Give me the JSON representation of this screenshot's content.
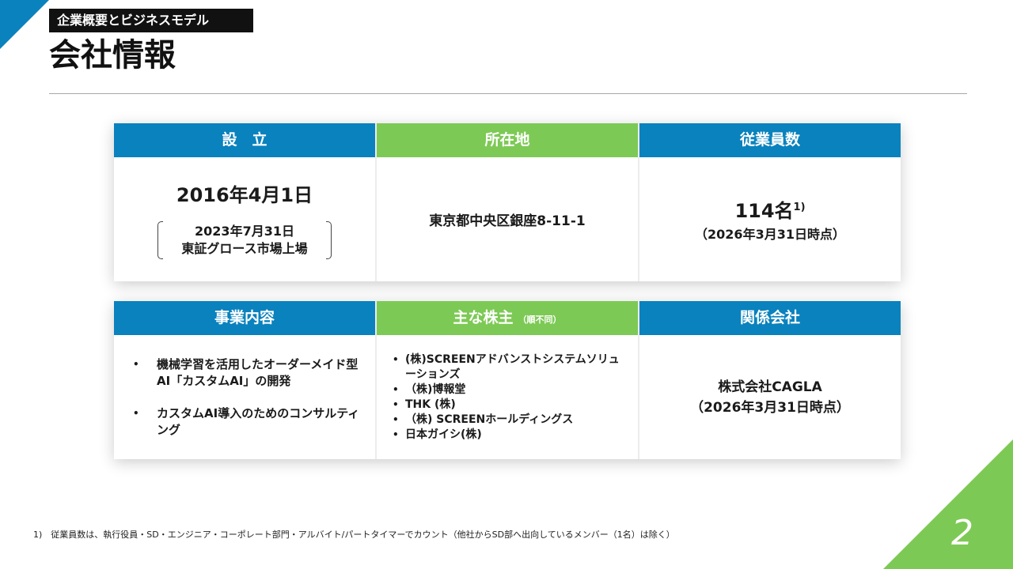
{
  "colors": {
    "blue": "#0a82bd",
    "green": "#7dc955"
  },
  "header": {
    "section_label": "企業概要とビジネスモデル",
    "title": "会社情報"
  },
  "founding": {
    "label": "設　立",
    "date": "2016年4月1日",
    "listing_date": "2023年7月31日",
    "listing_market": "東証グロース市場上場"
  },
  "location": {
    "label": "所在地",
    "address": "東京都中央区銀座8-11-1"
  },
  "employees": {
    "label": "従業員数",
    "count": "114名",
    "note_ref": "1)",
    "as_of": "（2026年3月31日時点）"
  },
  "business": {
    "label": "事業内容",
    "items": [
      "機械学習を活用したオーダーメイド型AI「カスタムAI」の開発",
      "カスタムAI導入のためのコンサルティング"
    ]
  },
  "shareholders": {
    "label": "主な株主",
    "sub_label": "（順不同）",
    "items": [
      "(株)SCREENアドバンストシステムソリューションズ",
      "（株)博報堂",
      "THK (株)",
      "（株) SCREENホールディングス",
      "日本ガイシ(株)"
    ]
  },
  "affiliate": {
    "label": "関係会社",
    "name": "株式会社CAGLA",
    "as_of": "（2026年3月31日時点）"
  },
  "footnote": "1)　従業員数は、執行役員・SD・エンジニア・コーポレート部門・アルバイト/パートタイマーでカウント（他社からSD部へ出向しているメンバー（1名）は除く）",
  "page_number": "2"
}
